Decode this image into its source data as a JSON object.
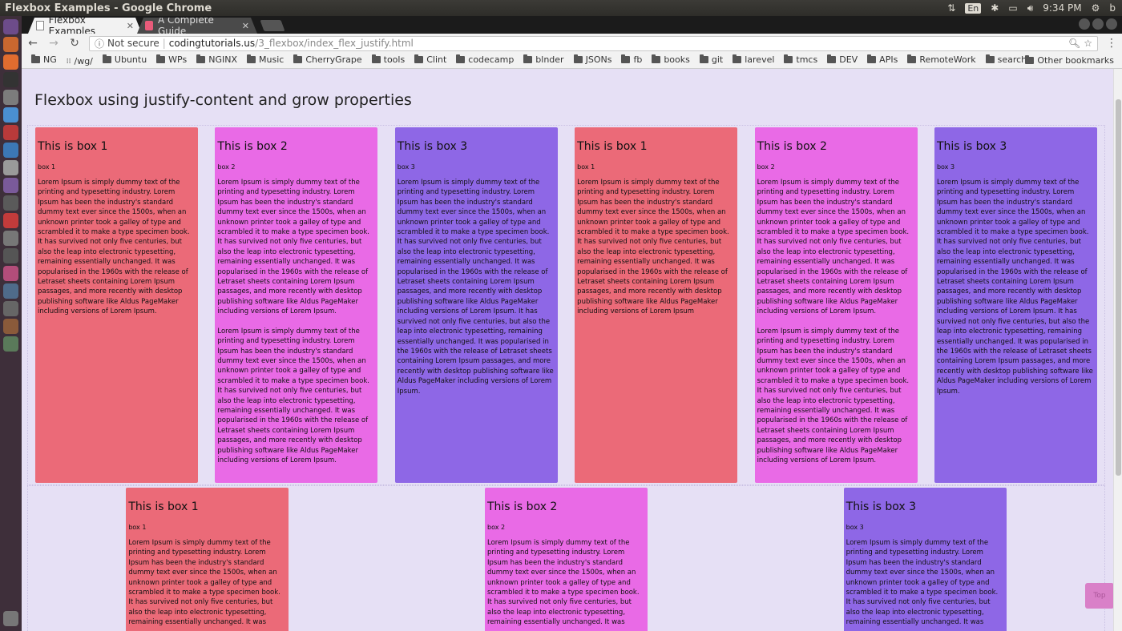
{
  "os": {
    "window_title": "Flexbox Examples - Google Chrome",
    "keyboard_layout": "En",
    "time": "9:34 PM",
    "user_initial": "b"
  },
  "launcher": {
    "icons": [
      "dash-icon",
      "files-icon",
      "firefox-icon",
      "terminal-icon",
      "settings-icon",
      "chrome-icon",
      "filezilla-icon",
      "vscode-icon",
      "text-editor-icon",
      "app-icon",
      "app-icon",
      "app-icon",
      "app-icon",
      "app-icon",
      "app-icon",
      "app-icon",
      "app-icon",
      "app-icon",
      "app-icon",
      "trash-icon"
    ]
  },
  "tabs": [
    {
      "title": "Flexbox Examples",
      "active": true
    },
    {
      "title": "A Complete Guide",
      "active": false
    }
  ],
  "toolbar": {
    "security": "Not secure",
    "url_host": "codingtutorials.us",
    "url_path": "/3_flexbox/index_flex_justify.html"
  },
  "bookmarks": {
    "items": [
      {
        "label": "NG",
        "icon": "folder-icon"
      },
      {
        "label": "/wg/",
        "icon": "apps-icon"
      },
      {
        "label": "Ubuntu",
        "icon": "folder-icon"
      },
      {
        "label": "WPs",
        "icon": "folder-icon"
      },
      {
        "label": "NGINX",
        "icon": "folder-icon"
      },
      {
        "label": "Music",
        "icon": "folder-icon"
      },
      {
        "label": "CherryGrape",
        "icon": "folder-icon"
      },
      {
        "label": "tools",
        "icon": "folder-icon"
      },
      {
        "label": "Clint",
        "icon": "folder-icon"
      },
      {
        "label": "codecamp",
        "icon": "folder-icon"
      },
      {
        "label": "blnder",
        "icon": "folder-icon"
      },
      {
        "label": "JSONs",
        "icon": "folder-icon"
      },
      {
        "label": "fb",
        "icon": "folder-icon"
      },
      {
        "label": "books",
        "icon": "folder-icon"
      },
      {
        "label": "git",
        "icon": "folder-icon"
      },
      {
        "label": "larevel",
        "icon": "folder-icon"
      },
      {
        "label": "tmcs",
        "icon": "folder-icon"
      },
      {
        "label": "DEV",
        "icon": "folder-icon"
      },
      {
        "label": "APIs",
        "icon": "folder-icon"
      },
      {
        "label": "RemoteWork",
        "icon": "folder-icon"
      },
      {
        "label": "search",
        "icon": "folder-icon"
      }
    ],
    "more": "»",
    "other": "Other bookmarks"
  },
  "page": {
    "title": "Flexbox using justify-content and grow properties",
    "row1": [
      {
        "heading": "This is box 1",
        "sub": "box 1",
        "paragraphs": [
          "Lorem Ipsum is simply dummy text of the printing and typesetting industry. Lorem Ipsum has been the industry's standard dummy text ever since the 1500s, when an unknown printer took a galley of type and scrambled it to make a type specimen book. It has survived not only five centuries, but also the leap into electronic typesetting, remaining essentially unchanged. It was popularised in the 1960s with the release of Letraset sheets containing Lorem Ipsum passages, and more recently with desktop publishing software like Aldus PageMaker including versions of Lorem Ipsum."
        ]
      },
      {
        "heading": "This is box 2",
        "sub": "box 2",
        "paragraphs": [
          "Lorem Ipsum is simply dummy text of the printing and typesetting industry. Lorem Ipsum has been the industry's standard dummy text ever since the 1500s, when an unknown printer took a galley of type and scrambled it to make a type specimen book. It has survived not only five centuries, but also the leap into electronic typesetting, remaining essentially unchanged. It was popularised in the 1960s with the release of Letraset sheets containing Lorem Ipsum passages, and more recently with desktop publishing software like Aldus PageMaker including versions of Lorem Ipsum.",
          "Lorem Ipsum is simply dummy text of the printing and typesetting industry. Lorem Ipsum has been the industry's standard dummy text ever since the 1500s, when an unknown printer took a galley of type and scrambled it to make a type specimen book. It has survived not only five centuries, but also the leap into electronic typesetting, remaining essentially unchanged. It was popularised in the 1960s with the release of Letraset sheets containing Lorem Ipsum passages, and more recently with desktop publishing software like Aldus PageMaker including versions of Lorem Ipsum."
        ]
      },
      {
        "heading": "This is box 3",
        "sub": "box 3",
        "paragraphs": [
          "Lorem Ipsum is simply dummy text of the printing and typesetting industry. Lorem Ipsum has been the industry's standard dummy text ever since the 1500s, when an unknown printer took a galley of type and scrambled it to make a type specimen book. It has survived not only five centuries, but also the leap into electronic typesetting, remaining essentially unchanged. It was popularised in the 1960s with the release of Letraset sheets containing Lorem Ipsum passages, and more recently with desktop publishing software like Aldus PageMaker including versions of Lorem Ipsum. It has survived not only five centuries, but also the leap into electronic typesetting, remaining essentially unchanged. It was popularised in the 1960s with the release of Letraset sheets containing Lorem Ipsum passages, and more recently with desktop publishing software like Aldus PageMaker including versions of Lorem Ipsum."
        ]
      },
      {
        "heading": "This is box 1",
        "sub": "box 1",
        "paragraphs": [
          "Lorem Ipsum is simply dummy text of the printing and typesetting industry. Lorem Ipsum has been the industry's standard dummy text ever since the 1500s, when an unknown printer took a galley of type and scrambled it to make a type specimen book. It has survived not only five centuries, but also the leap into electronic typesetting, remaining essentially unchanged. It was popularised in the 1960s with the release of Letraset sheets containing Lorem Ipsum passages, and more recently with desktop publishing software like Aldus PageMaker including versions of Lorem Ipsum"
        ]
      },
      {
        "heading": "This is box 2",
        "sub": "box 2",
        "paragraphs": [
          "Lorem Ipsum is simply dummy text of the printing and typesetting industry. Lorem Ipsum has been the industry's standard dummy text ever since the 1500s, when an unknown printer took a galley of type and scrambled it to make a type specimen book. It has survived not only five centuries, but also the leap into electronic typesetting, remaining essentially unchanged. It was popularised in the 1960s with the release of Letraset sheets containing Lorem Ipsum passages, and more recently with desktop publishing software like Aldus PageMaker including versions of Lorem Ipsum.",
          "Lorem Ipsum is simply dummy text of the printing and typesetting industry. Lorem Ipsum has been the industry's standard dummy text ever since the 1500s, when an unknown printer took a galley of type and scrambled it to make a type specimen book. It has survived not only five centuries, but also the leap into electronic typesetting, remaining essentially unchanged. It was popularised in the 1960s with the release of Letraset sheets containing Lorem Ipsum passages, and more recently with desktop publishing software like Aldus PageMaker including versions of Lorem Ipsum."
        ]
      },
      {
        "heading": "This is box 3",
        "sub": "box 3",
        "paragraphs": [
          "Lorem Ipsum is simply dummy text of the printing and typesetting industry. Lorem Ipsum has been the industry's standard dummy text ever since the 1500s, when an unknown printer took a galley of type and scrambled it to make a type specimen book. It has survived not only five centuries, but also the leap into electronic typesetting, remaining essentially unchanged. It was popularised in the 1960s with the release of Letraset sheets containing Lorem Ipsum passages, and more recently with desktop publishing software like Aldus PageMaker including versions of Lorem Ipsum. It has survived not only five centuries, but also the leap into electronic typesetting, remaining essentially unchanged. It was popularised in the 1960s with the release of Letraset sheets containing Lorem Ipsum passages, and more recently with desktop publishing software like Aldus PageMaker including versions of Lorem Ipsum."
        ]
      }
    ],
    "row2": [
      {
        "heading": "This is box 1",
        "sub": "box 1",
        "paragraphs": [
          "Lorem Ipsum is simply dummy text of the printing and typesetting industry. Lorem Ipsum has been the industry's standard dummy text ever since the 1500s, when an unknown printer took a galley of type and scrambled it to make a type specimen book. It has survived not only five centuries, but also the leap into electronic typesetting, remaining essentially unchanged. It was"
        ]
      },
      {
        "heading": "This is box 2",
        "sub": "box 2",
        "paragraphs": [
          "Lorem Ipsum is simply dummy text of the printing and typesetting industry. Lorem Ipsum has been the industry's standard dummy text ever since the 1500s, when an unknown printer took a galley of type and scrambled it to make a type specimen book. It has survived not only five centuries, but also the leap into electronic typesetting, remaining essentially unchanged. It was"
        ]
      },
      {
        "heading": "This is box 3",
        "sub": "box 3",
        "paragraphs": [
          "Lorem Ipsum is simply dummy text of the printing and typesetting industry. Lorem Ipsum has been the industry's standard dummy text ever since the 1500s, when an unknown printer took a galley of type and scrambled it to make a type specimen book. It has survived not only five centuries, but also the leap into electronic typesetting, remaining essentially unchanged. It was"
        ]
      }
    ],
    "top_button": "Top"
  }
}
